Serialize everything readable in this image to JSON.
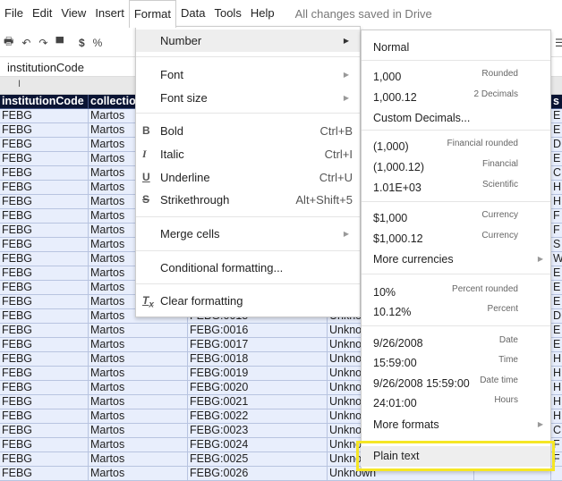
{
  "menubar": {
    "items": [
      "File",
      "Edit",
      "View",
      "Insert",
      "Format",
      "Data",
      "Tools",
      "Help"
    ],
    "status": "All changes saved in Drive"
  },
  "toolbar": {
    "currency": "$",
    "percent": "%"
  },
  "formula_bar": {
    "value": "institutionCode"
  },
  "column_header": {
    "label": "I"
  },
  "sheet": {
    "headers": [
      "institutionCode",
      "collectio",
      "",
      "",
      "",
      "s"
    ],
    "rows": [
      [
        "FEBG",
        "Martos",
        "",
        "",
        "",
        "E"
      ],
      [
        "FEBG",
        "Martos",
        "",
        "",
        "",
        "E"
      ],
      [
        "FEBG",
        "Martos",
        "",
        "",
        "",
        "D"
      ],
      [
        "FEBG",
        "Martos",
        "",
        "",
        "",
        "E"
      ],
      [
        "FEBG",
        "Martos",
        "",
        "",
        "",
        "C"
      ],
      [
        "FEBG",
        "Martos",
        "",
        "",
        "",
        "H"
      ],
      [
        "FEBG",
        "Martos",
        "",
        "",
        "",
        "H"
      ],
      [
        "FEBG",
        "Martos",
        "",
        "",
        "",
        "F"
      ],
      [
        "FEBG",
        "Martos",
        "",
        "",
        "",
        "F"
      ],
      [
        "FEBG",
        "Martos",
        "",
        "",
        "",
        "S"
      ],
      [
        "FEBG",
        "Martos",
        "",
        "",
        "",
        "W"
      ],
      [
        "FEBG",
        "Martos",
        "",
        "",
        "",
        "E"
      ],
      [
        "FEBG",
        "Martos",
        "",
        "",
        "",
        "E"
      ],
      [
        "FEBG",
        "Martos",
        "",
        "",
        "",
        "E"
      ],
      [
        "FEBG",
        "Martos",
        "FEBG:0015",
        "Unknown",
        "",
        "D"
      ],
      [
        "FEBG",
        "Martos",
        "FEBG:0016",
        "Unknown",
        "",
        "E"
      ],
      [
        "FEBG",
        "Martos",
        "FEBG:0017",
        "Unknown",
        "",
        "E"
      ],
      [
        "FEBG",
        "Martos",
        "FEBG:0018",
        "Unknown",
        "",
        "H"
      ],
      [
        "FEBG",
        "Martos",
        "FEBG:0019",
        "Unknown",
        "",
        "H"
      ],
      [
        "FEBG",
        "Martos",
        "FEBG:0020",
        "Unknown",
        "",
        "H"
      ],
      [
        "FEBG",
        "Martos",
        "FEBG:0021",
        "Unknown",
        "",
        "H"
      ],
      [
        "FEBG",
        "Martos",
        "FEBG:0022",
        "Unknown",
        "",
        "H"
      ],
      [
        "FEBG",
        "Martos",
        "FEBG:0023",
        "Unknown",
        "",
        "C"
      ],
      [
        "FEBG",
        "Martos",
        "FEBG:0024",
        "Unknown",
        "",
        "F"
      ],
      [
        "FEBG",
        "Martos",
        "FEBG:0025",
        "Unknown",
        "",
        "F"
      ],
      [
        "FEBG",
        "Martos",
        "FEBG:0026",
        "Unknown",
        "",
        ""
      ]
    ]
  },
  "format_menu": {
    "number": "Number",
    "font": "Font",
    "font_size": "Font size",
    "bold": "Bold",
    "bold_sc": "Ctrl+B",
    "italic": "Italic",
    "italic_sc": "Ctrl+I",
    "underline": "Underline",
    "underline_sc": "Ctrl+U",
    "strike": "Strikethrough",
    "strike_sc": "Alt+Shift+5",
    "merge": "Merge cells",
    "conditional": "Conditional formatting...",
    "clear": "Clear formatting"
  },
  "number_menu": {
    "items": [
      {
        "label": "Normal",
        "desc": ""
      },
      {
        "label": "1,000",
        "desc": "Rounded"
      },
      {
        "label": "1,000.12",
        "desc": "2 Decimals"
      },
      {
        "label": "Custom Decimals...",
        "desc": ""
      },
      {
        "label": "(1,000)",
        "desc": "Financial rounded"
      },
      {
        "label": "(1,000.12)",
        "desc": "Financial"
      },
      {
        "label": "1.01E+03",
        "desc": "Scientific"
      },
      {
        "label": "$1,000",
        "desc": "Currency"
      },
      {
        "label": "$1,000.12",
        "desc": "Currency"
      },
      {
        "label": "More currencies",
        "desc": ""
      },
      {
        "label": "10%",
        "desc": "Percent rounded"
      },
      {
        "label": "10.12%",
        "desc": "Percent"
      },
      {
        "label": "9/26/2008",
        "desc": "Date"
      },
      {
        "label": "15:59:00",
        "desc": "Time"
      },
      {
        "label": "9/26/2008 15:59:00",
        "desc": "Date time"
      },
      {
        "label": "24:01:00",
        "desc": "Hours"
      },
      {
        "label": "More formats",
        "desc": ""
      }
    ],
    "plain_text": "Plain text"
  },
  "colors": {
    "highlight": "#f5e625",
    "header_bg": "#0a1433",
    "cell_bg": "#e8eefc"
  }
}
